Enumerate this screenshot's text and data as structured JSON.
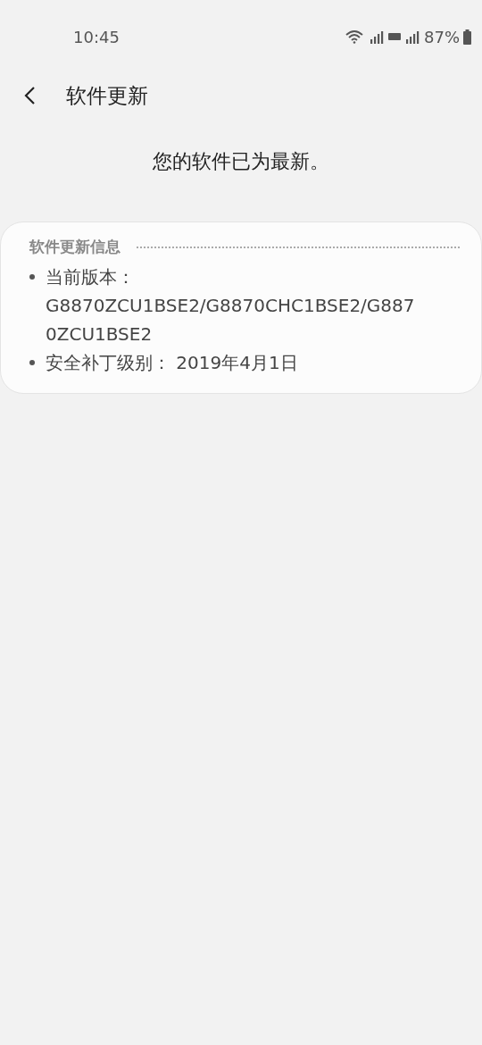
{
  "status_bar": {
    "time": "10:45",
    "battery": "87%"
  },
  "header": {
    "title": "软件更新"
  },
  "message": "您的软件已为最新。",
  "info_card": {
    "title": "软件更新信息",
    "items": [
      "当前版本：G8870ZCU1BSE2/G8870CHC1BSE2/G8870ZCU1BSE2",
      "安全补丁级别： 2019年4月1日"
    ]
  }
}
